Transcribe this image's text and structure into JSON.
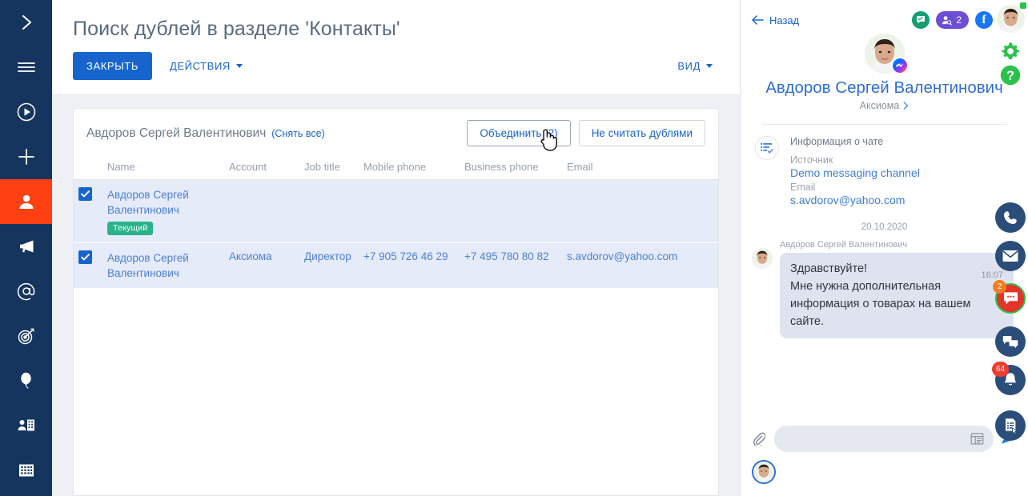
{
  "left_nav": {
    "items": [
      {
        "name": "expand-collapse",
        "icon": "chevron-right-icon"
      },
      {
        "name": "menu",
        "icon": "hamburger-icon"
      },
      {
        "name": "run-process",
        "icon": "play-circle-icon"
      },
      {
        "name": "add-record",
        "icon": "plus-icon"
      },
      {
        "name": "contacts",
        "icon": "person-icon",
        "active": true
      },
      {
        "name": "campaigns",
        "icon": "megaphone-icon"
      },
      {
        "name": "email",
        "icon": "at-icon"
      },
      {
        "name": "targets",
        "icon": "target-icon"
      },
      {
        "name": "events",
        "icon": "balloon-icon"
      },
      {
        "name": "accounts",
        "icon": "person-building-icon"
      },
      {
        "name": "directory",
        "icon": "building-icon"
      }
    ]
  },
  "header": {
    "title": "Поиск дублей в разделе 'Контакты'",
    "close_button": "ЗАКРЫТЬ",
    "actions_button": "ДЕЙСТВИЯ",
    "view_button": "ВИД"
  },
  "results": {
    "group_title": "Авдоров Сергей Валентинович",
    "clear_all": "(Снять все)",
    "merge_button": "Объединить (2)",
    "not_duplicate_button": "Не считать дублями",
    "columns": [
      "Name",
      "Account",
      "Job title",
      "Mobile phone",
      "Business phone",
      "Email"
    ],
    "rows": [
      {
        "checked": true,
        "name": "Авдоров Сергей Валентинович",
        "badge": "Текущий",
        "account": "",
        "job_title": "",
        "mobile_phone": "",
        "business_phone": "",
        "email": ""
      },
      {
        "checked": true,
        "name": "Авдоров Сергей Валентинович",
        "badge": "",
        "account": "Аксиома",
        "job_title": "Директор",
        "mobile_phone": "+7 905 726 46 29",
        "business_phone": "+7 495 780 80 82",
        "email": "s.avdorov@yahoo.com"
      }
    ]
  },
  "chat_panel": {
    "back_label": "Назад",
    "chips": [
      {
        "name": "messages-chip",
        "type": "green",
        "label": ""
      },
      {
        "name": "contacts-chip",
        "type": "purple",
        "label": "2"
      },
      {
        "name": "facebook-chip",
        "type": "fb",
        "label": "f"
      }
    ],
    "contact_name": "Авдоров Сергей Валентинович",
    "contact_account": "Аксиома",
    "info": {
      "heading": "Информация о чате",
      "source_label": "Источник",
      "source_value": "Demo messaging channel",
      "email_label": "Email",
      "email_value": "s.avdorov@yahoo.com"
    },
    "date_separator": "20.10.2020",
    "message": {
      "author": "Авдоров Сергей Валентинович",
      "line1": "Здравствуйте!",
      "line2": "Мне нужна дополнительная",
      "line3": "информация о товарах на вашем",
      "line4": "сайте.",
      "time": "16:07"
    },
    "composer_placeholder": ""
  },
  "right_rail": {
    "items": [
      {
        "name": "user-avatar",
        "icon": "avatar-icon"
      },
      {
        "name": "settings",
        "icon": "gear-icon"
      },
      {
        "name": "help",
        "icon": "question-circle-icon"
      },
      {
        "name": "call",
        "icon": "phone-icon"
      },
      {
        "name": "mail",
        "icon": "envelope-icon"
      },
      {
        "name": "chats",
        "icon": "chat-bubble-icon",
        "badge": "2"
      },
      {
        "name": "feed",
        "icon": "comments-icon"
      },
      {
        "name": "notifications",
        "icon": "bell-icon",
        "badge": "64"
      },
      {
        "name": "tasks",
        "icon": "document-click-icon"
      }
    ]
  },
  "colors": {
    "nav_bg": "#16355e",
    "nav_active": "#ff4013",
    "accent_blue": "#1765cc",
    "badge_green": "#2bb388",
    "row_selected": "#e6ebfa",
    "rail_navy": "#2a4d79",
    "rail_green": "#29c24a",
    "badge_orange": "#f57c20",
    "badge_red": "#ef3e2e"
  }
}
